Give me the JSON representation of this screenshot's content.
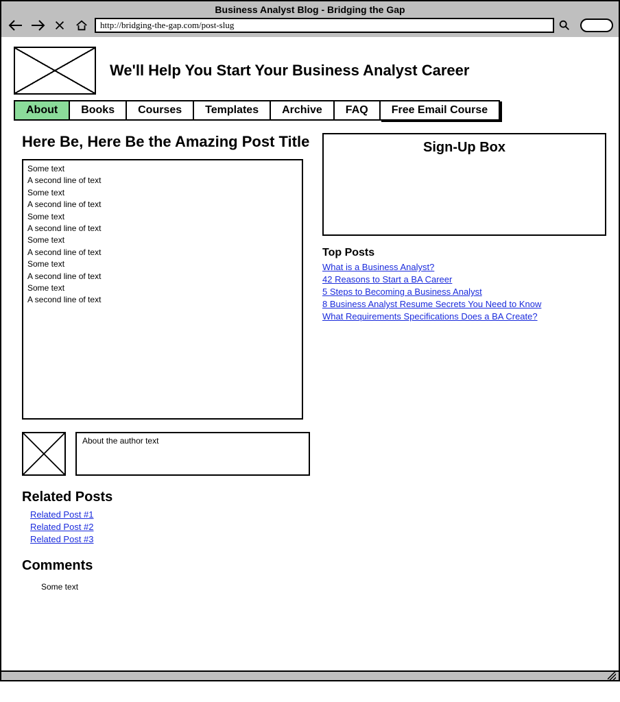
{
  "browser": {
    "title": "Business Analyst Blog - Bridging the Gap",
    "url": "http://bridging-the-gap.com/post-slug"
  },
  "header": {
    "tagline": "We'll Help You Start Your Business Analyst Career"
  },
  "nav": {
    "tabs": [
      {
        "label": "About",
        "active": true
      },
      {
        "label": "Books",
        "active": false
      },
      {
        "label": "Courses",
        "active": false
      },
      {
        "label": "Templates",
        "active": false
      },
      {
        "label": "Archive",
        "active": false
      },
      {
        "label": "FAQ",
        "active": false
      },
      {
        "label": "Free Email Course",
        "active": false
      }
    ]
  },
  "post": {
    "title": "Here Be, Here Be the Amazing Post Title",
    "body_lines": [
      "Some text",
      "A second line of text",
      "Some text",
      "A second line of text",
      "Some text",
      "A second line of text",
      "Some text",
      "A second line of text",
      "Some text",
      "A second line of text",
      "Some text",
      "A second line of text"
    ]
  },
  "author": {
    "bio": "About the author text"
  },
  "related": {
    "heading": "Related Posts",
    "items": [
      "Related Post #1",
      "Related Post #2",
      "Related Post #3"
    ]
  },
  "comments": {
    "heading": "Comments",
    "body": "Some text"
  },
  "sidebar": {
    "signup_title": "Sign-Up Box",
    "top_posts_heading": "Top Posts",
    "top_posts": [
      "What is a Business Analyst?",
      "42 Reasons to Start a BA Career",
      "5 Steps to Becoming a Business Analyst",
      "8 Business Analyst Resume Secrets You Need to Know",
      "What Requirements Specifications Does a BA Create?"
    ]
  }
}
